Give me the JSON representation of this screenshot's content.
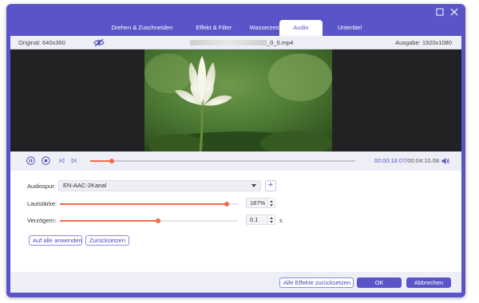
{
  "tabs": [
    {
      "label": "Drehen & Zuschneiden",
      "active": false
    },
    {
      "label": "Effekt & Filter",
      "active": false
    },
    {
      "label": "Wasserzeichen",
      "active": false
    },
    {
      "label": "Audio",
      "active": true
    },
    {
      "label": "Untertitel",
      "active": false
    }
  ],
  "window": {
    "maximize_icon": "maximize-icon",
    "close_icon": "close-icon"
  },
  "infobar": {
    "original": "Original: 640x360",
    "eye_icon": "eye-slash-icon",
    "filename_suffix": "_0_0.mp4",
    "output": "Ausgabe: 1920x1080"
  },
  "playback": {
    "current_time": "00:00:18.07",
    "separator": "/",
    "total_time": "00:04:10.08",
    "progress_fraction": 0.08,
    "icons": [
      "pause-icon",
      "stop-icon",
      "previous-frame-icon",
      "next-frame-icon",
      "volume-icon"
    ]
  },
  "audio": {
    "track_label": "Audiospur:",
    "track_value": "EN-AAC-2Kanal",
    "volume_label": "Lautstärke:",
    "volume_value": "187%",
    "volume_fraction": 0.935,
    "delay_label": "Verzögern:",
    "delay_value": "0.1",
    "delay_unit": "s",
    "delay_fraction": 0.55
  },
  "actions": {
    "apply_all": "Auf alle anwenden",
    "reset": "Zurücksetzen",
    "reset_all_effects": "Alle Effekte zurücksetzen",
    "ok": "OK",
    "cancel": "Abbrechen"
  },
  "colors": {
    "accent": "#5955c8",
    "slider": "#f46a4a",
    "panel": "#eeeef6"
  }
}
